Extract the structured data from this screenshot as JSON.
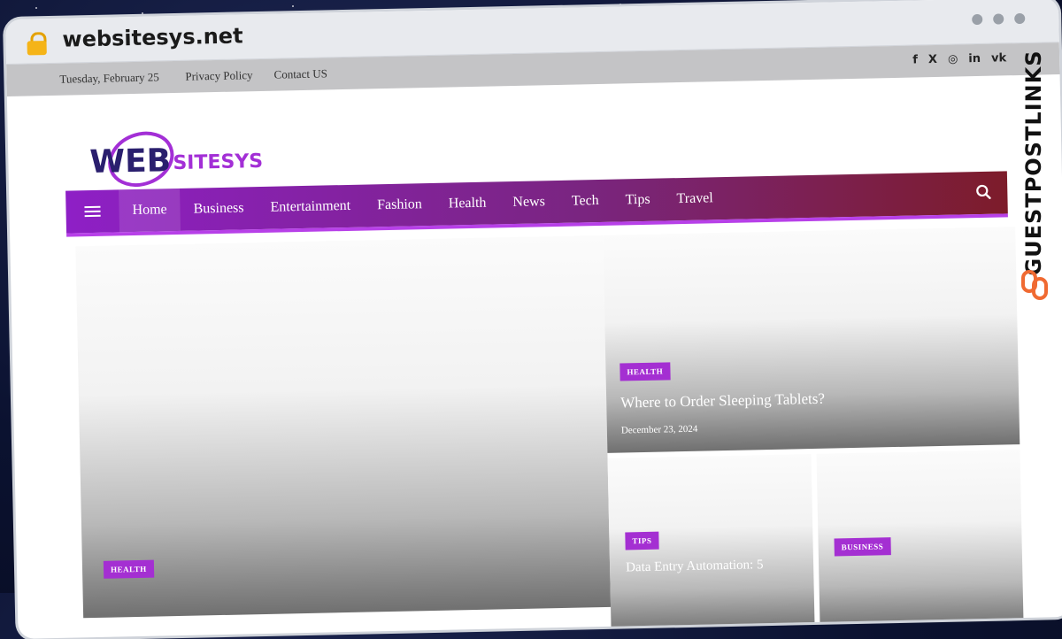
{
  "browser": {
    "domain": "websitesys.net"
  },
  "topbar": {
    "date": "Tuesday, February 25",
    "links": [
      "Privacy Policy",
      "Contact US"
    ],
    "social": [
      "f",
      "X",
      "◎",
      "in",
      "vk"
    ]
  },
  "logo": {
    "big": "WEB",
    "small": "SITESYS"
  },
  "nav": {
    "items": [
      "Home",
      "Business",
      "Entertainment",
      "Fashion",
      "Health",
      "News",
      "Tech",
      "Tips",
      "Travel"
    ],
    "active": "Home"
  },
  "posts": {
    "featured": {
      "category": "HEALTH"
    },
    "top_right": {
      "category": "HEALTH",
      "title": "Where to Order Sleeping Tablets?",
      "date": "December 23, 2024"
    },
    "bottom_left": {
      "category": "TIPS",
      "title": "Data Entry Automation: 5"
    },
    "bottom_right": {
      "category": "BUSINESS"
    }
  },
  "watermark": {
    "text": "GUESTPOSTLINKS"
  },
  "colors": {
    "accent": "#a42fd2",
    "nav_start": "#8e1fc6",
    "nav_end": "#7d1c2a"
  }
}
